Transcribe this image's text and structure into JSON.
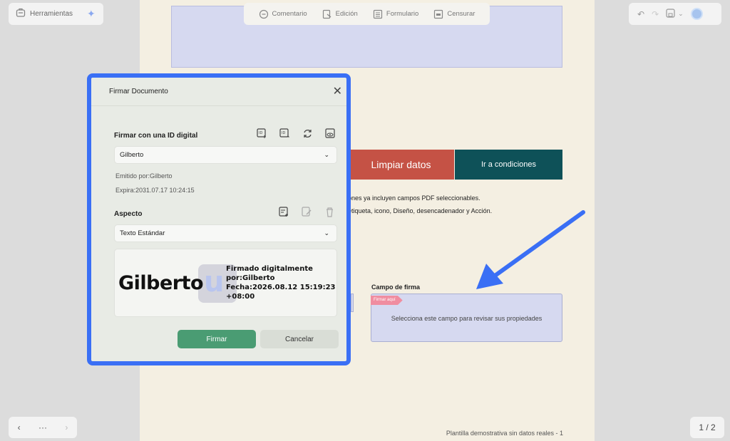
{
  "toolbar": {
    "tools_label": "Herramientas",
    "center_tools": [
      "Comentario",
      "Edición",
      "Formulario",
      "Censurar"
    ]
  },
  "document": {
    "clear_button": "Limpiar datos",
    "conditions_button": "Ir a condiciones",
    "line1": "ones ya incluyen campos PDF seleccionables.",
    "line2": "etiqueta, icono, Diseño, desencadenador y Acción.",
    "signature_label": "Campo de firma",
    "signature_tag": "Firmar aquí",
    "signature_hint": "Selecciona este campo para revisar sus propiedades",
    "footer": "Plantilla demostrativa sin datos reales - 1"
  },
  "pagination": {
    "page_count": "1 / 2",
    "more": "···"
  },
  "dialog": {
    "title": "Firmar Documento",
    "digital_id_heading": "Firmar con una ID digital",
    "selected_id": "Gilberto",
    "issued_by": "Emitido por:Gilberto",
    "expires": "Expira:2031.07.17 10:24:15",
    "appearance_heading": "Aspecto",
    "appearance_value": "Texto Estándar",
    "preview": {
      "name": "Gilberto",
      "logo_letter": "u",
      "line1": "Firmado digitalmente",
      "line2": "por:Gilberto",
      "line3": "Fecha:2026.08.12 15:19:23",
      "line4": "+08:00"
    },
    "sign_button": "Firmar",
    "cancel_button": "Cancelar"
  },
  "colors": {
    "accent_frame": "#3a6ff5",
    "sign_button": "#4a9c73",
    "clear_button": "#c55245",
    "conditions_button": "#0e5158",
    "arrow": "#3a6ff5"
  }
}
